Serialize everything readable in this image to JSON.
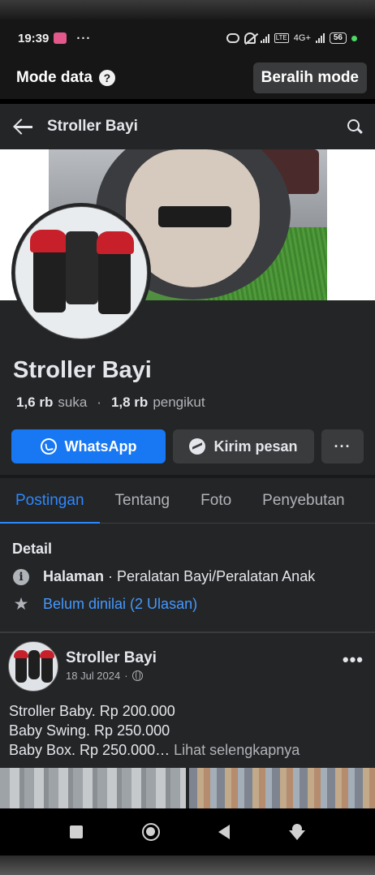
{
  "status_bar": {
    "time": "19:39",
    "dots": "···",
    "network": "4G+",
    "battery": "56"
  },
  "mode_bar": {
    "label": "Mode data",
    "help_symbol": "?",
    "switch_label": "Beralih mode"
  },
  "header": {
    "title": "Stroller Bayi"
  },
  "profile": {
    "name": "Stroller Bayi",
    "likes_count": "1,6 rb",
    "likes_label": "suka",
    "followers_count": "1,8 rb",
    "followers_label": "pengikut"
  },
  "actions": {
    "whatsapp_label": "WhatsApp",
    "message_label": "Kirim pesan",
    "more_label": "···"
  },
  "tabs": [
    {
      "label": "Postingan",
      "active": true
    },
    {
      "label": "Tentang",
      "active": false
    },
    {
      "label": "Foto",
      "active": false
    },
    {
      "label": "Penyebutan",
      "active": false
    }
  ],
  "detail": {
    "title": "Detail",
    "info_icon_glyph": "i",
    "category_prefix": "Halaman",
    "category_text": " · Peralatan Bayi/Peralatan Anak",
    "rating_text": "Belum dinilai (2 Ulasan)"
  },
  "post": {
    "author": "Stroller Bayi",
    "date": "18 Jul 2024",
    "meta_dot": "·",
    "more_label": "•••",
    "lines": [
      "Stroller Baby. Rp 200.000",
      "Baby Swing. Rp 250.000",
      "Baby Box. Rp 250.000…"
    ],
    "see_more": "Lihat selengkapnya"
  },
  "colors": {
    "accent": "#1877f2",
    "tab_active": "#2d88ff",
    "link": "#4599ff",
    "surface": "#242526"
  }
}
